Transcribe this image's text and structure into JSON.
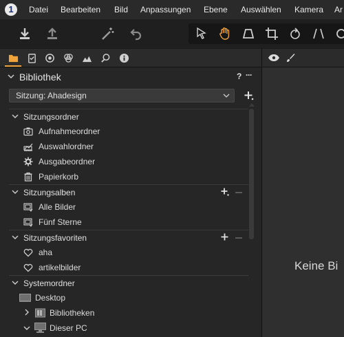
{
  "menubar": {
    "items": [
      "Datei",
      "Bearbeiten",
      "Bild",
      "Anpassungen",
      "Ebene",
      "Auswählen",
      "Kamera",
      "Ar"
    ],
    "app_icon_label": "1"
  },
  "toolbar": {
    "icons": [
      "import-icon",
      "export-icon",
      "magic-wand-icon",
      "undo-icon",
      "select-cursor-icon",
      "hand-pan-icon",
      "crop-icon",
      "keystone-icon",
      "rotate-icon",
      "straighten-icon"
    ]
  },
  "tabs": {
    "icons": [
      "folder-icon",
      "clipboard-icon",
      "capture-icon",
      "adjust-icon",
      "exposure-icon",
      "search-icon",
      "info-icon"
    ],
    "active": "folder-icon"
  },
  "library": {
    "title": "Bibliothek",
    "help": "?",
    "more": "···",
    "session_select": "Sitzung: Ahadesign"
  },
  "sections": {
    "session_folders": {
      "label": "Sitzungsordner",
      "items": [
        "Aufnahmeordner",
        "Auswahlordner",
        "Ausgabeordner",
        "Papierkorb"
      ]
    },
    "session_albums": {
      "label": "Sitzungsalben",
      "items": [
        "Alle Bilder",
        "Fünf Sterne"
      ]
    },
    "session_favorites": {
      "label": "Sitzungsfavoriten",
      "items": [
        "aha",
        "artikelbilder"
      ]
    },
    "system_folders": {
      "label": "Systemordner",
      "items": [
        "Desktop",
        "Bibliotheken",
        "Dieser PC"
      ]
    }
  },
  "viewer": {
    "empty_text": "Keine Bi"
  },
  "colors": {
    "accent": "#f0a33a",
    "panel": "#262626",
    "viewer": "#2f2f2f"
  }
}
